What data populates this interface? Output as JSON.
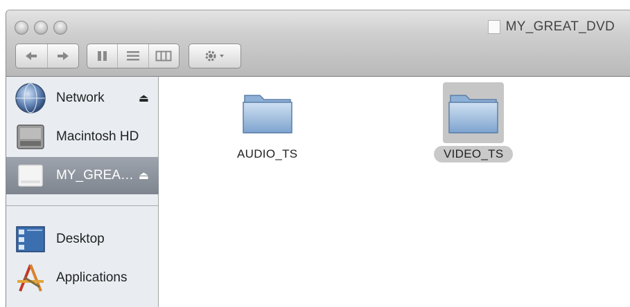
{
  "window": {
    "title": "MY_GREAT_DVD"
  },
  "toolbar": {
    "back_icon": "back-arrow-icon",
    "forward_icon": "forward-arrow-icon",
    "views": [
      "icon-view",
      "list-view",
      "column-view"
    ],
    "action_icon": "gear-icon"
  },
  "sidebar": {
    "devices": [
      {
        "label": "Network",
        "icon": "network-globe-icon",
        "eject": "⏏"
      },
      {
        "label": "Macintosh HD",
        "icon": "hard-drive-icon"
      },
      {
        "label": "MY_GREA…",
        "icon": "dvd-disc-icon",
        "eject": "⏏",
        "selected": true
      }
    ],
    "places": [
      {
        "label": "Desktop",
        "icon": "desktop-icon"
      },
      {
        "label": "Applications",
        "icon": "applications-icon"
      }
    ]
  },
  "content": {
    "items": [
      {
        "label": "AUDIO_TS",
        "icon": "folder-icon",
        "selected": false
      },
      {
        "label": "VIDEO_TS",
        "icon": "folder-icon",
        "selected": true
      }
    ]
  }
}
